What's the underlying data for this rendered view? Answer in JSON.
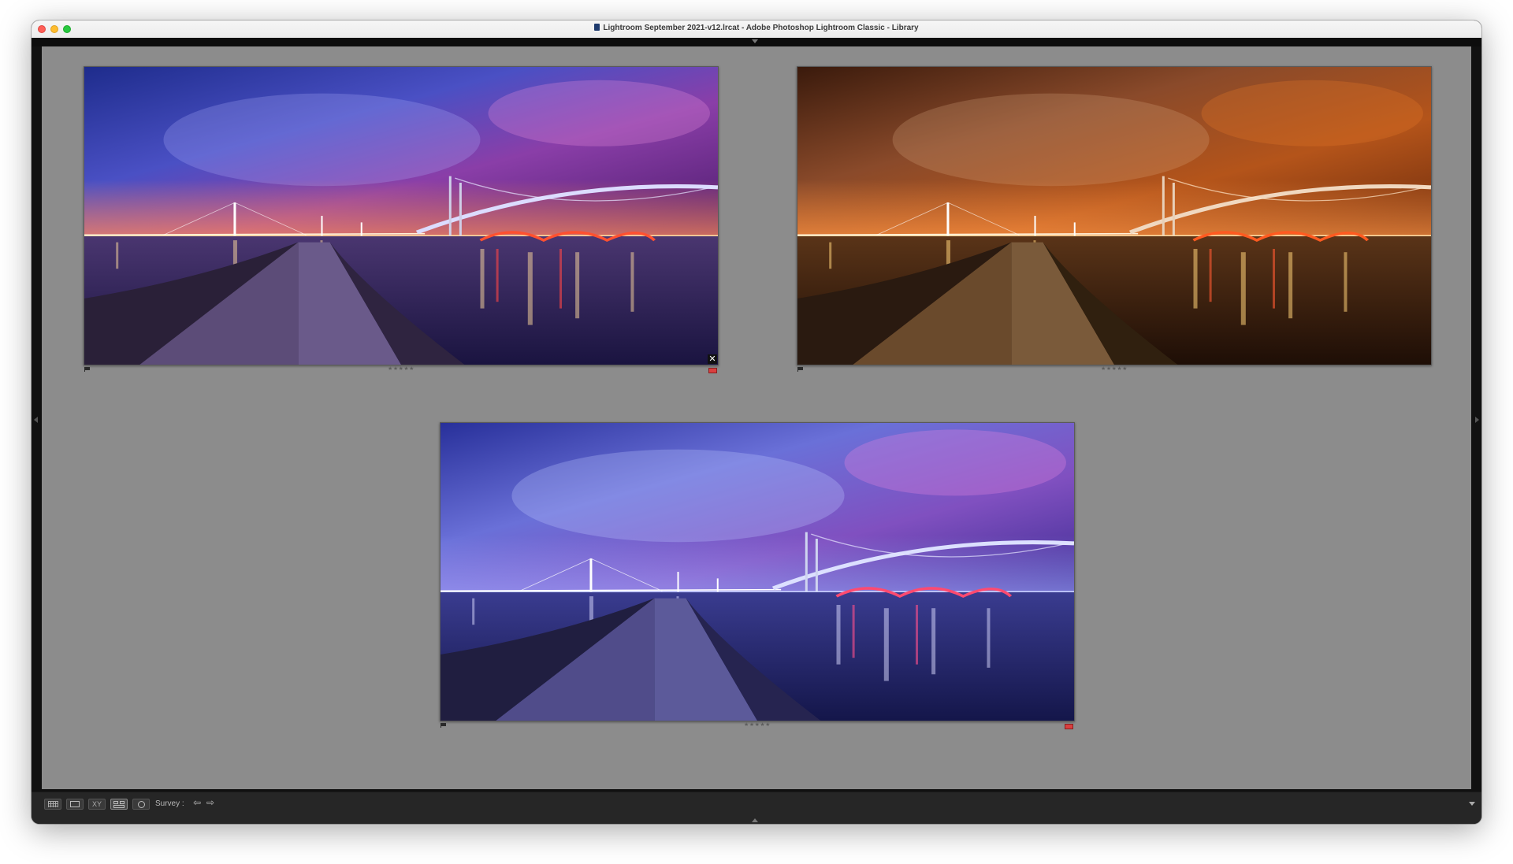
{
  "window": {
    "title": "Lightroom September 2021-v12.lrcat - Adobe Photoshop Lightroom Classic - Library"
  },
  "photos": [
    {
      "name": "photo-1",
      "stars": "★★★★★",
      "has_color_label": true,
      "has_close": true,
      "palette": "purple"
    },
    {
      "name": "photo-2",
      "stars": "★★★★★",
      "has_color_label": false,
      "has_close": false,
      "palette": "orange"
    },
    {
      "name": "photo-3",
      "stars": "★★★★★",
      "has_color_label": true,
      "has_close": false,
      "palette": "blue"
    }
  ],
  "toolbar": {
    "grid_view_icon": "grid-view-icon",
    "loupe_view_icon": "loupe-view-icon",
    "compare_view_label": "XY",
    "survey_view_icon": "survey-view-icon",
    "people_view_icon": "people-view-icon",
    "mode_label": "Survey :",
    "prev_arrow": "⇦",
    "next_arrow": "⇨"
  },
  "colors": {
    "canvas": "#8c8c8c",
    "toolbar": "#262626",
    "color_label_red": "#d94040"
  }
}
